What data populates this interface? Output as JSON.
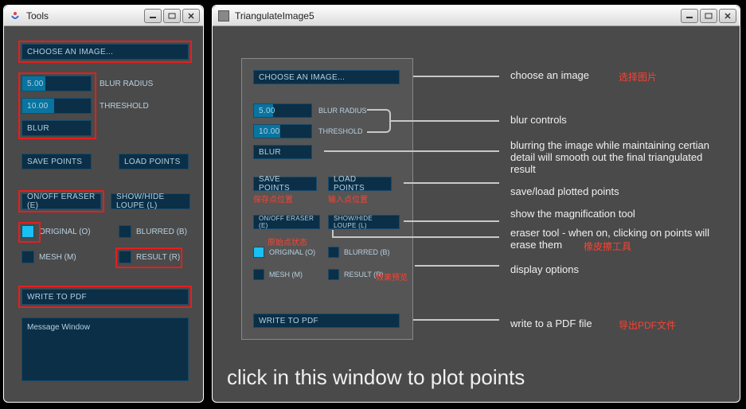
{
  "tools_window": {
    "title": "Tools",
    "choose_image": "CHOOSE AN IMAGE...",
    "blur_radius_val": "5.00",
    "blur_radius_label": "BLUR RADIUS",
    "threshold_val": "10.00",
    "threshold_label": "THRESHOLD",
    "blur_btn": "BLUR",
    "save_points": "SAVE POINTS",
    "load_points": "LOAD POINTS",
    "eraser": "ON/OFF ERASER (E)",
    "loupe": "SHOW/HIDE LOUPE (L)",
    "original": "ORIGINAL (O)",
    "blurred": "BLURRED (B)",
    "mesh": "MESH (M)",
    "result": "RESULT (R)",
    "write_pdf": "WRITE TO PDF",
    "msg_window": "Message Window"
  },
  "preview_window": {
    "title": "TriangulateImage5",
    "hint": "click in this window to plot points"
  },
  "annotations": {
    "choose_image": "choose an image",
    "choose_image_zh": "选择图片",
    "blur_controls": "blur controls",
    "blur_desc": "blurring the image while maintaining certian detail will smooth out the final triangulated result",
    "save_load": "save/load plotted points",
    "save_zh": "保存点位置",
    "load_zh": "输入点位置",
    "magnify": "show the magnification tool",
    "eraser_desc": "eraser tool - when on, clicking on points will erase them",
    "eraser_zh": "橡皮擦工具",
    "original_zh": "原始点状态",
    "display_opts": "display options",
    "result_zh": "效果预览",
    "pdf": "write to a PDF file",
    "pdf_zh": "导出PDF文件"
  }
}
